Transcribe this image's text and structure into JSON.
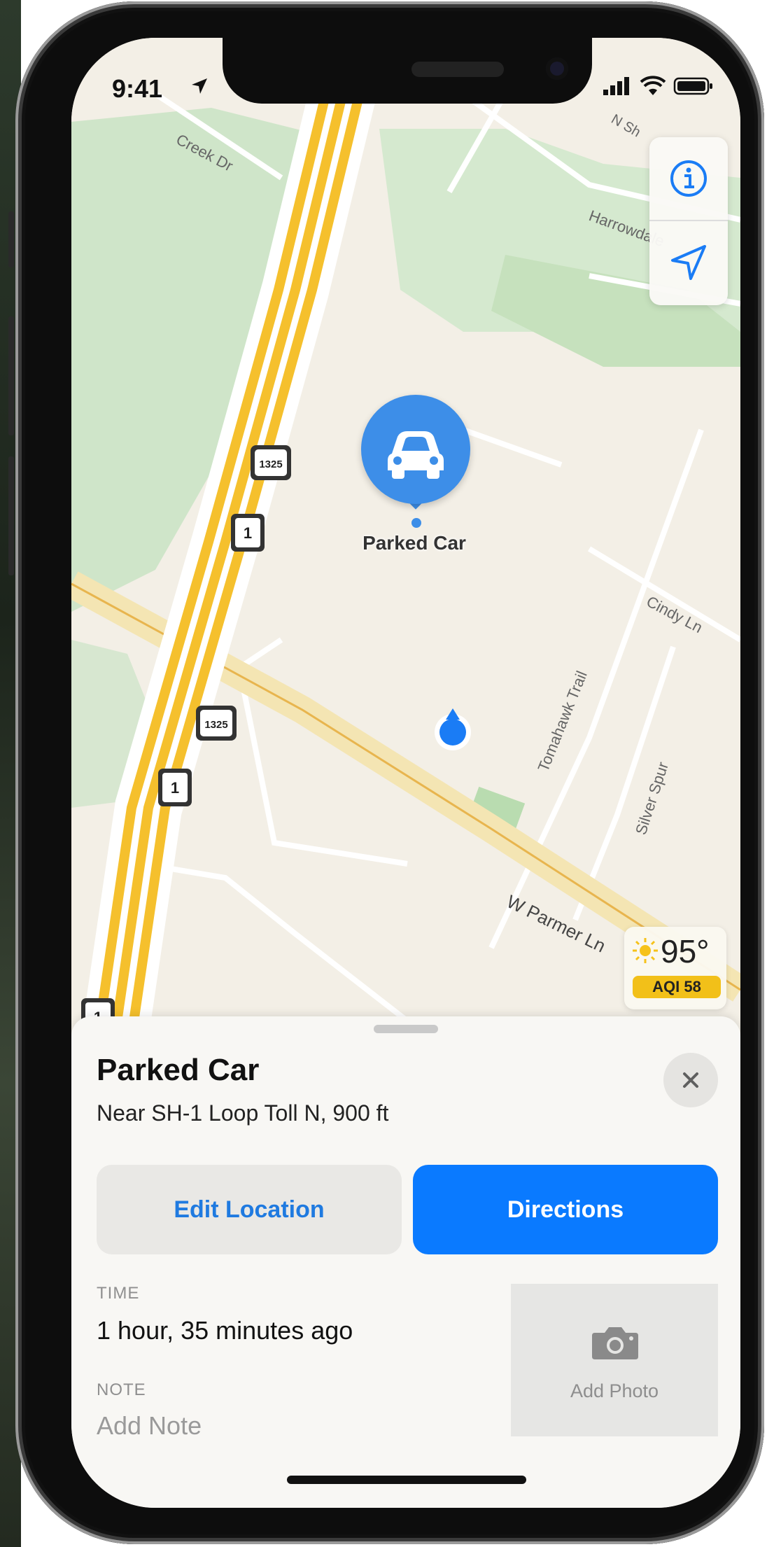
{
  "status_bar": {
    "time": "9:41"
  },
  "map": {
    "street_labels": [
      "Creek Dr",
      "N Sh",
      "Harrowdale",
      "Cindy Ln",
      "Tomahawk Trail",
      "Silver Spur",
      "W Parmer Ln"
    ],
    "highway_shields": [
      "1325",
      "1",
      "1325",
      "1",
      "1"
    ],
    "parked_car_label": "Parked Car",
    "weather": {
      "temperature": "95°",
      "aqi": "AQI 58"
    }
  },
  "sheet": {
    "title": "Parked Car",
    "subtitle": "Near SH-1 Loop Toll N, 900 ft",
    "edit_location_label": "Edit Location",
    "directions_label": "Directions",
    "time_label": "TIME",
    "time_value": "1 hour, 35 minutes ago",
    "note_label": "NOTE",
    "note_placeholder": "Add Note",
    "add_photo_label": "Add Photo"
  },
  "colors": {
    "accent": "#0a7aff",
    "pin": "#3d8ee8",
    "aqi_badge": "#f2c019",
    "map_background": "#f3efe6",
    "highway": "#f5c02d"
  }
}
